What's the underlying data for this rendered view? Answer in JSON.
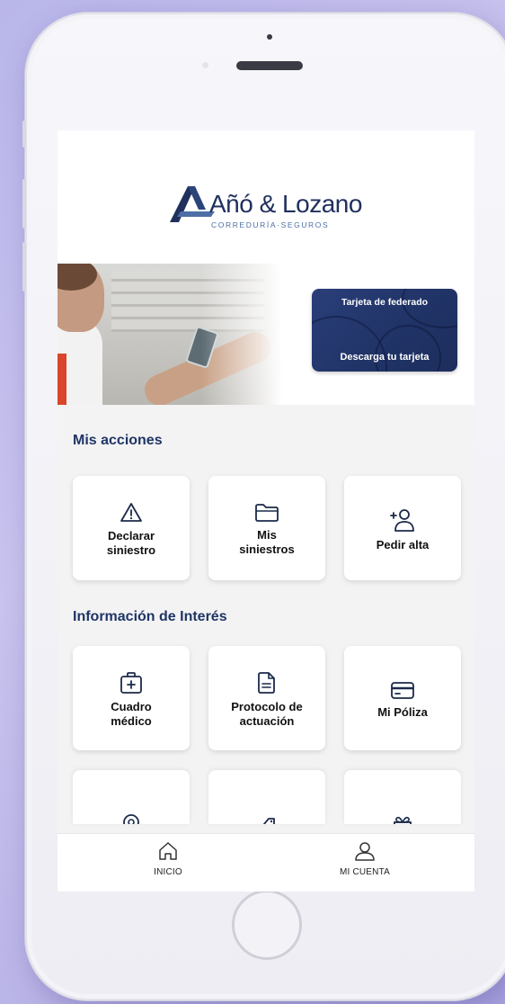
{
  "app": {
    "logo": {
      "name": "Añó & Lozano",
      "subtitle": "CORREDURÍA·SEGUROS"
    }
  },
  "banner": {
    "card_title": "Tarjeta de federado",
    "card_link": "Descarga tu tarjeta"
  },
  "sections": {
    "acciones_title": "Mis acciones",
    "interes_title": "Información de Interés"
  },
  "acciones": [
    {
      "label": "Declarar\nsiniestro",
      "icon": "warning-triangle-icon"
    },
    {
      "label": "Mis\nsiniestros",
      "icon": "folder-icon"
    },
    {
      "label": "Pedir alta",
      "icon": "add-user-icon"
    }
  ],
  "interes": [
    {
      "label": "Cuadro\nmédico",
      "icon": "medical-kit-icon"
    },
    {
      "label": "Protocolo de\nactuación",
      "icon": "document-icon"
    },
    {
      "label": "Mi Póliza",
      "icon": "credit-card-icon"
    }
  ],
  "tabbar": {
    "home": "INICIO",
    "account": "MI CUENTA"
  },
  "colors": {
    "brand_navy": "#1f3564",
    "card_bg": "#24386f",
    "screen_bg": "#f3f3f4"
  }
}
